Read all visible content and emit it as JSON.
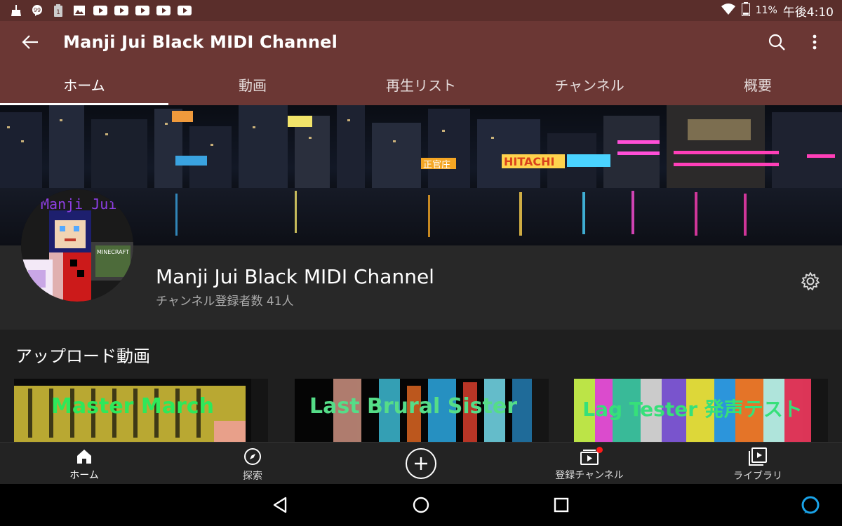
{
  "status_bar": {
    "notification_icons": [
      "broom-icon",
      "chat-icon",
      "battery-info-icon",
      "image-icon",
      "youtube-icon",
      "youtube-icon",
      "youtube-icon",
      "youtube-icon",
      "youtube-icon"
    ],
    "battery": "11%",
    "time": "午後4:10"
  },
  "app_bar": {
    "title": "Manji Jui Black MIDI Channel"
  },
  "tabs": [
    {
      "label": "ホーム",
      "active": true
    },
    {
      "label": "動画",
      "active": false
    },
    {
      "label": "再生リスト",
      "active": false
    },
    {
      "label": "チャンネル",
      "active": false
    },
    {
      "label": "概要",
      "active": false
    }
  ],
  "banner": {
    "signs": [
      "HITACHI",
      "正官庄"
    ]
  },
  "channel": {
    "avatar_text": "Manji Jui",
    "avatar_badge": "MINECRAFT",
    "name": "Manji Jui Black MIDI Channel",
    "subscribers": "チャンネル登録者数 41人"
  },
  "uploads": {
    "title": "アップロード動画",
    "videos": [
      {
        "title": "Master March",
        "title_color": "#2ee85a"
      },
      {
        "title": "Last Brural Sister",
        "title_color": "#55dd88"
      },
      {
        "title": "Lag Tester 発声テスト",
        "title_color": "#36e07a"
      }
    ]
  },
  "bottom_nav": [
    {
      "label": "ホーム",
      "icon": "home-icon"
    },
    {
      "label": "探索",
      "icon": "compass-icon"
    },
    {
      "label": "",
      "icon": "add-icon"
    },
    {
      "label": "登録チャンネル",
      "icon": "subscriptions-icon"
    },
    {
      "label": "ライブラリ",
      "icon": "library-icon"
    }
  ],
  "colors": {
    "status_bar": "#5a2e2b",
    "app_bar": "#6b3734",
    "surface": "#282828",
    "background": "#1f1f1f",
    "notification_dot": "#ff1a1a",
    "alexa": "#1aa3e8"
  }
}
